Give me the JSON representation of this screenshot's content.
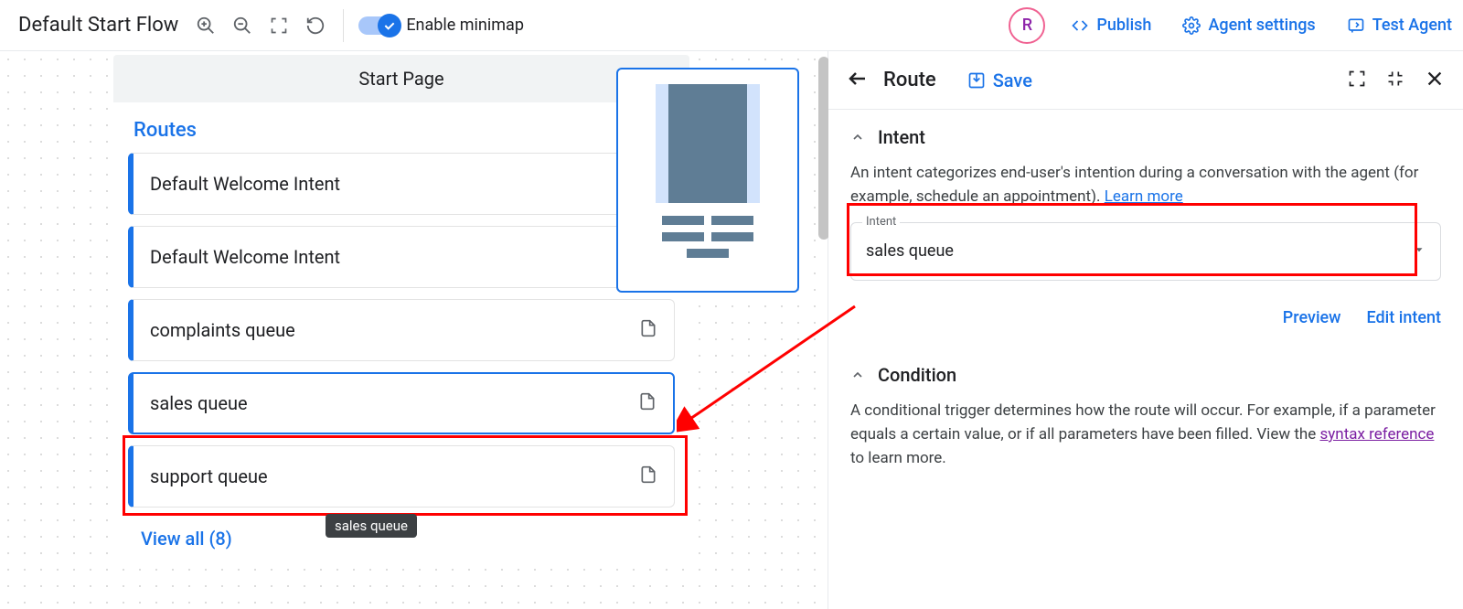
{
  "header": {
    "flow_title": "Default Start Flow",
    "minimap_label": "Enable minimap",
    "avatar_initial": "R",
    "publish": "Publish",
    "agent_settings": "Agent settings",
    "test_agent": "Test Agent"
  },
  "node": {
    "title": "Start Page",
    "section": "Routes",
    "routes": [
      {
        "label": "Default Welcome Intent",
        "has_page": false
      },
      {
        "label": "Default Welcome Intent",
        "has_page": false
      },
      {
        "label": "complaints queue",
        "has_page": true
      },
      {
        "label": "sales queue",
        "has_page": true,
        "selected": true
      },
      {
        "label": "support queue",
        "has_page": true
      }
    ],
    "tooltip": "sales queue",
    "view_all": "View all (8)"
  },
  "panel": {
    "title": "Route",
    "save": "Save",
    "intent": {
      "heading": "Intent",
      "description_pre": "An intent categorizes end-user's intention during a conversation with the agent (for example, schedule an appointment). ",
      "learn_more": "Learn more",
      "field_label": "Intent",
      "value": "sales queue",
      "preview": "Preview",
      "edit": "Edit intent"
    },
    "condition": {
      "heading": "Condition",
      "description_pre": "A conditional trigger determines how the route will occur. For example, if a parameter equals a certain value, or if all parameters have been filled. View the ",
      "syntax": "syntax reference",
      "description_post": " to learn more."
    }
  }
}
